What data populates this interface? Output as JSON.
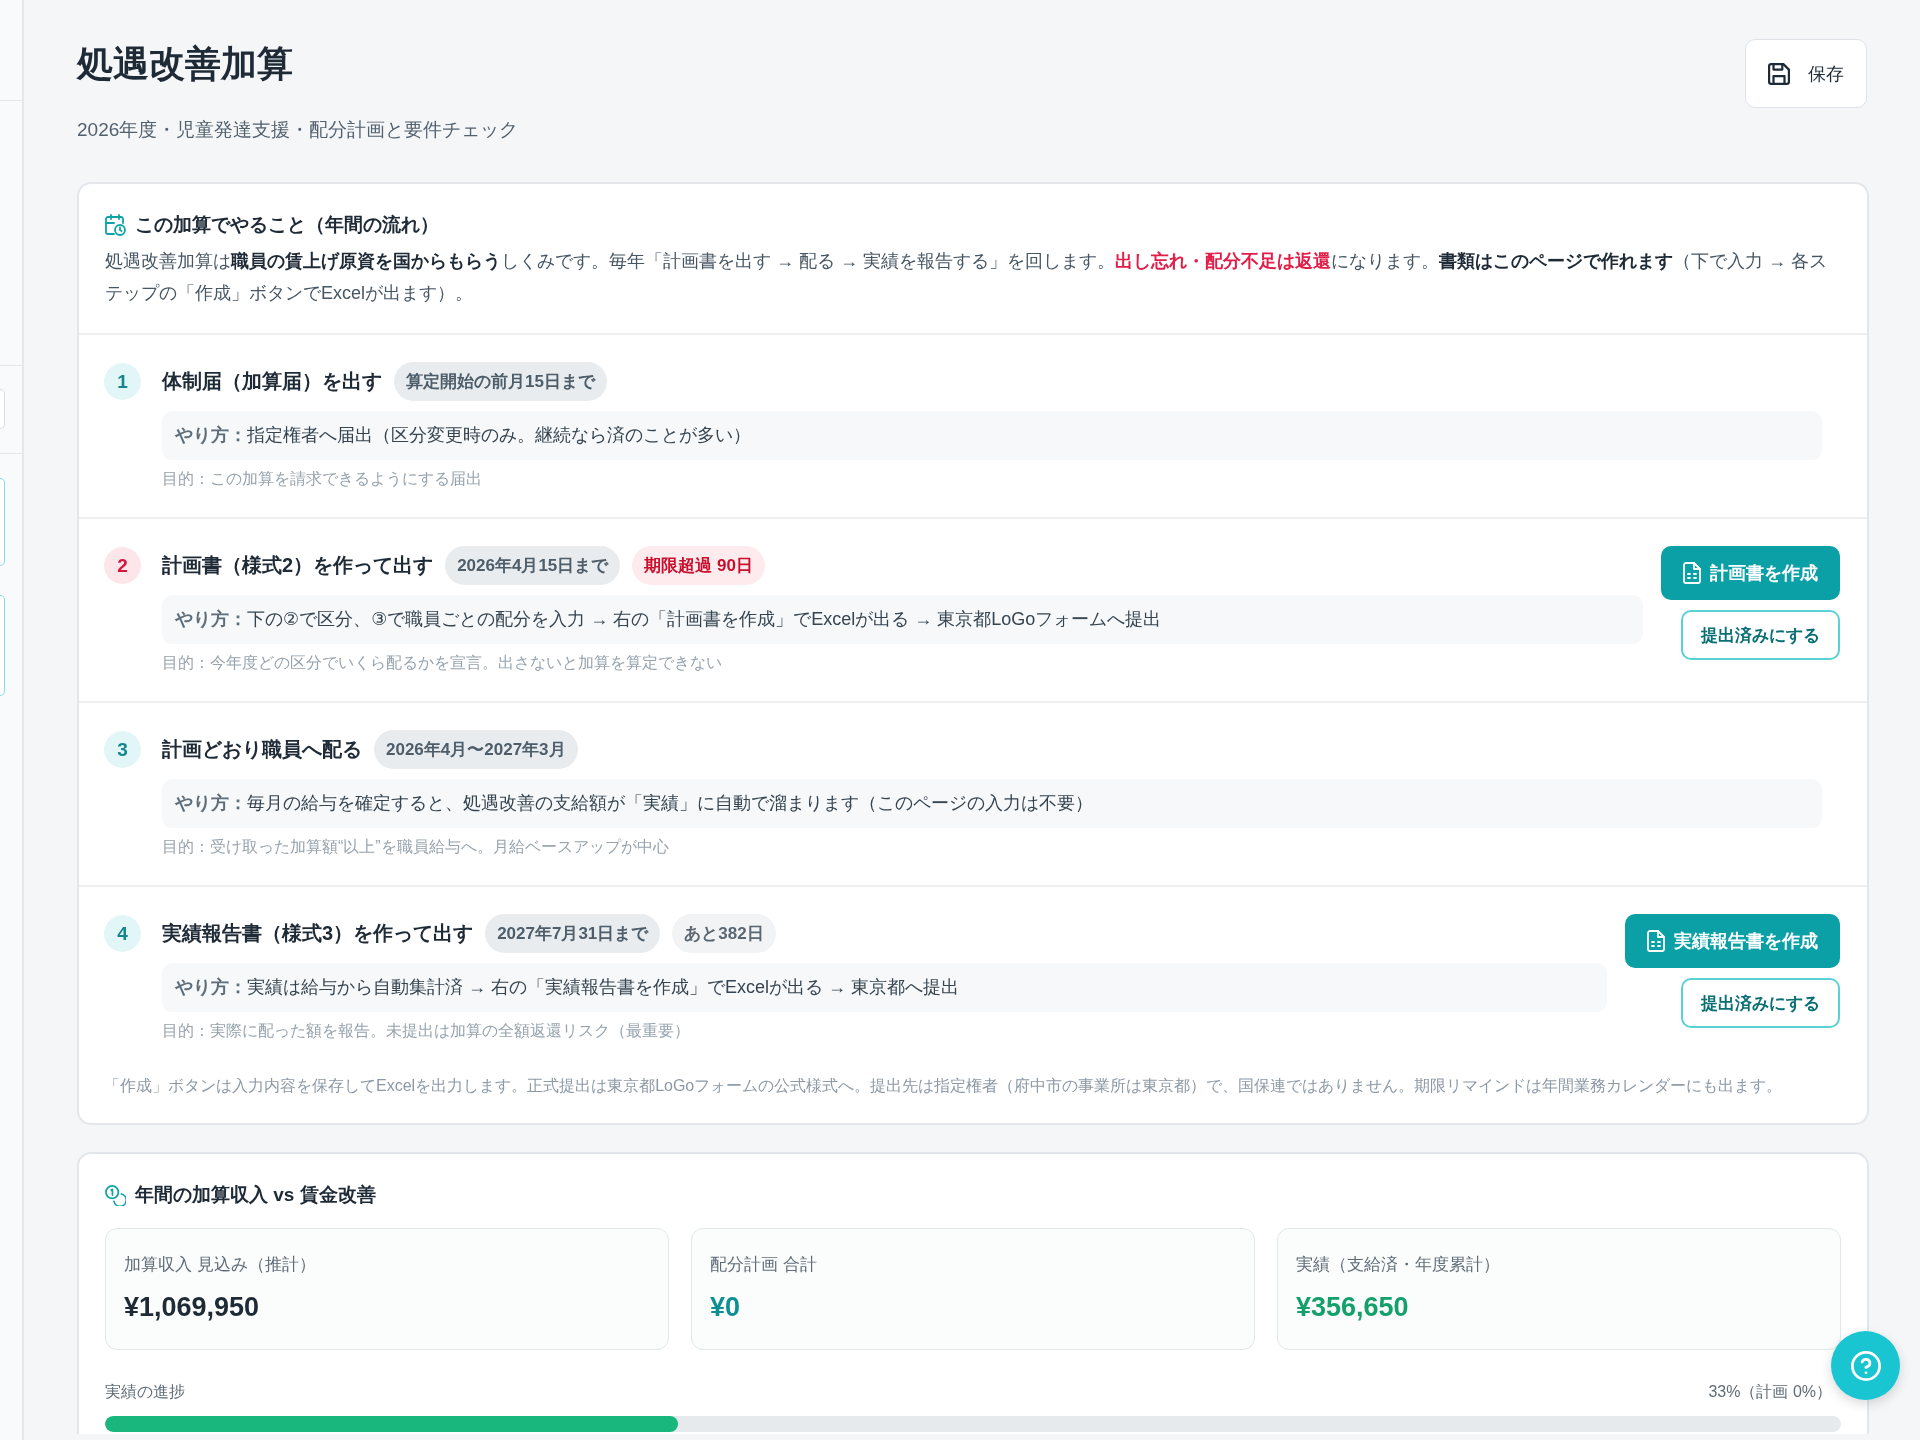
{
  "page": {
    "title": "処遇改善加算",
    "subtitle": "2026年度・児童発達支援・配分計画と要件チェック"
  },
  "save_button": {
    "label": "保存"
  },
  "flow_card": {
    "title": "この加算でやること（年間の流れ）",
    "intro": [
      {
        "kind": "plain",
        "text": "処遇改善加算は"
      },
      {
        "kind": "strong",
        "text": "職員の賃上げ原資を国からもらう"
      },
      {
        "kind": "plain",
        "text": "しくみです。毎年「計画書を出す → 配る → 実績を報告する」を回します。"
      },
      {
        "kind": "alert",
        "text": "出し忘れ・配分不足は返還"
      },
      {
        "kind": "plain",
        "text": "になります。"
      },
      {
        "kind": "strong",
        "text": "書類はこのページで作れます"
      },
      {
        "kind": "plain",
        "text": "（下で入力 → 各ステップの「作成」ボタンでExcelが出ます）。"
      }
    ],
    "steps": [
      {
        "number": "1",
        "title": "体制届（加算届）を出す",
        "overdue": false,
        "badges": [
          {
            "kind": "deadline",
            "text": "算定開始の前月15日まで"
          }
        ],
        "how_to": "**やり方：**指定権者へ届出（区分変更時のみ。継続なら済のことが多い）",
        "purpose": "目的：この加算を請求できるようにする届出"
      },
      {
        "number": "2",
        "title": "計画書（様式2）を作って出す",
        "overdue": true,
        "badges": [
          {
            "kind": "deadline",
            "text": "2026年4月15日まで"
          },
          {
            "kind": "overdue",
            "text": "期限超過 90日"
          }
        ],
        "how_to": "**やり方：**下の②で区分、③で職員ごとの配分を入力 → 右の「計画書を作成」でExcelが出る → 東京都LoGoフォームへ提出",
        "purpose": "目的：今年度どの区分でいくら配るかを宣言。出さないと加算を算定できない",
        "actions": [
          {
            "kind": "create",
            "label": "計画書を作成"
          },
          {
            "kind": "mark_done",
            "label": "提出済みにする"
          }
        ]
      },
      {
        "number": "3",
        "title": "計画どおり職員へ配る",
        "overdue": false,
        "badges": [
          {
            "kind": "period",
            "text": "2026年4月〜2027年3月"
          }
        ],
        "how_to": "**やり方：**毎月の給与を確定すると、処遇改善の支給額が「実績」に自動で溜まります（このページの入力は不要）",
        "purpose": "目的：受け取った加算額“以上”を職員給与へ。月給ベースアップが中心"
      },
      {
        "number": "4",
        "title": "実績報告書（様式3）を作って出す",
        "overdue": false,
        "badges": [
          {
            "kind": "deadline",
            "text": "2027年7月31日まで"
          },
          {
            "kind": "remaining",
            "text": "あと382日"
          }
        ],
        "how_to": "**やり方：**実績は給与から自動集計済 → 右の「実績報告書を作成」でExcelが出る → 東京都へ提出",
        "purpose": "目的：実際に配った額を報告。未提出は加算の全額返還リスク（最重要）",
        "actions": [
          {
            "kind": "create",
            "label": "実績報告書を作成"
          },
          {
            "kind": "mark_done",
            "label": "提出済みにする"
          }
        ]
      }
    ],
    "note": "「作成」ボタンは入力内容を保存してExcelを出力します。正式提出は東京都LoGoフォームの公式様式へ。提出先は指定権者（府中市の事業所は東京都）で、国保連ではありません。期限リマインドは年間業務カレンダーにも出ます。"
  },
  "income_card": {
    "title": "年間の加算収入 vs 賃金改善",
    "stats": [
      {
        "label": "加算収入 見込み（推計）",
        "value": "¥1,069,950",
        "color": "#1e2a36"
      },
      {
        "label": "配分計画 合計",
        "value": "¥0",
        "color": "#0e8f94"
      },
      {
        "label": "実績（支給済・年度累計）",
        "value": "¥356,650",
        "color": "#13a06a"
      }
    ],
    "progress": {
      "label": "実績の進捗",
      "reading": "33%（計画 0%）",
      "level": 0.33
    }
  }
}
